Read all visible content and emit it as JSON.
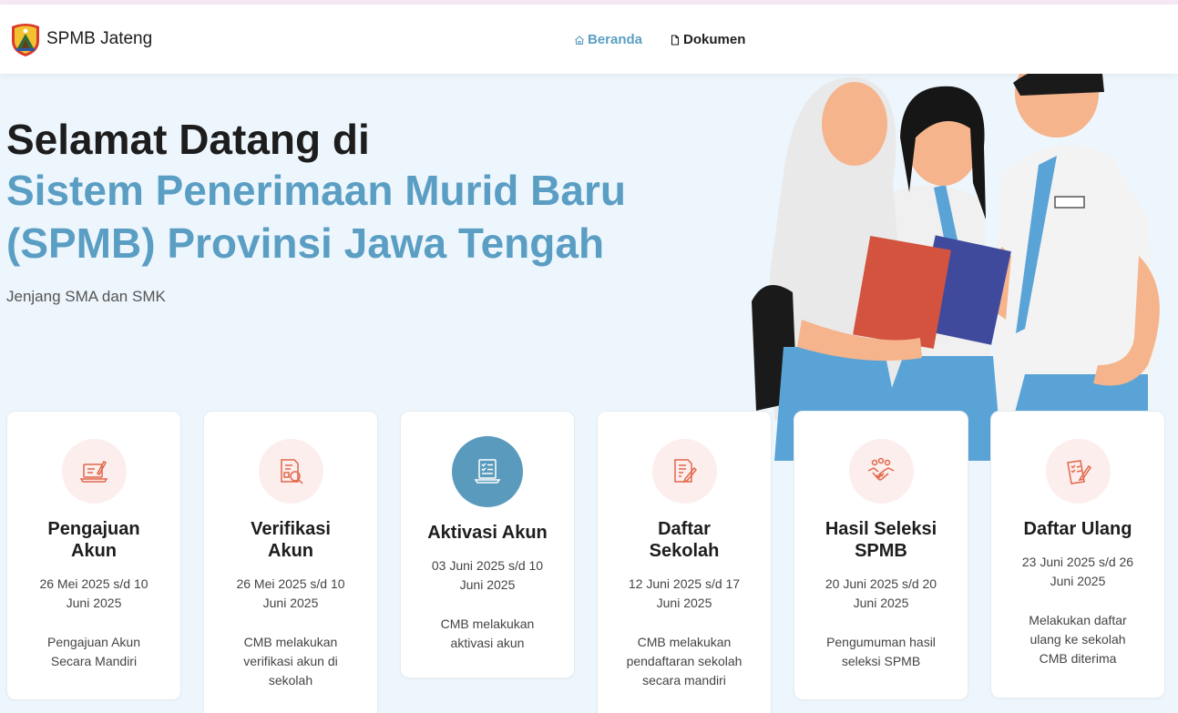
{
  "brand": {
    "name": "SPMB Jateng",
    "logo_icon": "jateng-emblem-icon"
  },
  "nav": {
    "items": [
      {
        "label": "Beranda",
        "icon": "home-icon",
        "active": true
      },
      {
        "label": "Dokumen",
        "icon": "document-icon",
        "active": false
      }
    ]
  },
  "hero": {
    "title_line1": "Selamat Datang di",
    "title_line2": "Sistem Penerimaan Murid Baru",
    "title_line3": "(SPMB) Provinsi Jawa Tengah",
    "subtitle": "Jenjang SMA dan SMK"
  },
  "colors": {
    "accent": "#5b9ec4",
    "icon_orange": "#e0674a",
    "icon_bg": "#fdeeee",
    "active_icon_bg": "#5a9abd"
  },
  "steps": [
    {
      "title": "Pengajuan Akun",
      "date": "26 Mei 2025 s/d 10 Juni 2025",
      "desc": "Pengajuan Akun Secara Mandiri",
      "icon": "laptop-form-icon"
    },
    {
      "title": "Verifikasi Akun",
      "date": "26 Mei 2025 s/d 10 Juni 2025",
      "desc": "CMB melakukan verifikasi akun di sekolah",
      "icon": "document-search-icon"
    },
    {
      "title": "Aktivasi Akun",
      "date": "03 Juni 2025 s/d 10 Juni 2025",
      "desc": "CMB melakukan aktivasi akun",
      "icon": "laptop-checklist-icon"
    },
    {
      "title": "Daftar Sekolah",
      "date": "12 Juni 2025 s/d 17 Juni 2025",
      "desc": "CMB melakukan pendaftaran sekolah secara mandiri",
      "icon": "document-pen-icon"
    },
    {
      "title": "Hasil Seleksi SPMB",
      "date": "20 Juni 2025 s/d 20 Juni 2025",
      "desc": "Pengumuman hasil seleksi SPMB",
      "icon": "handshake-icon"
    },
    {
      "title": "Daftar Ulang",
      "date": "23 Juni 2025 s/d 26 Juni 2025",
      "desc": "Melakukan daftar ulang ke sekolah CMB diterima",
      "icon": "checklist-pen-icon"
    }
  ]
}
